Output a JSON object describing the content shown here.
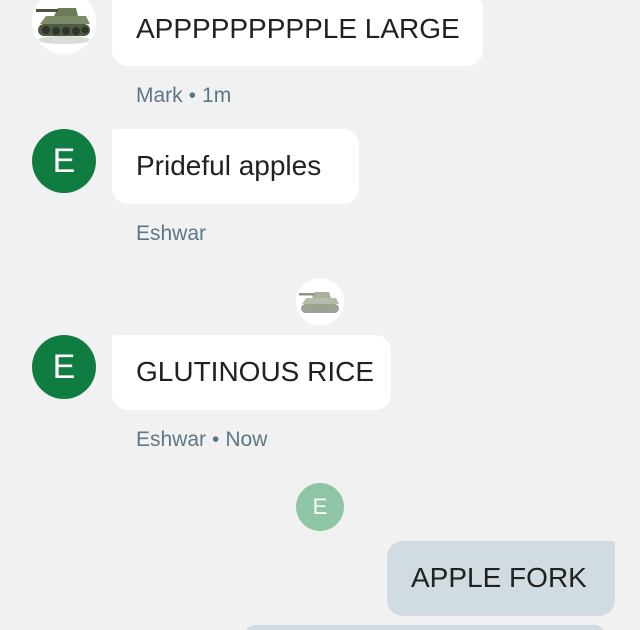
{
  "messages": [
    {
      "sender": "Mark",
      "text": "APPPPPPPPPLE LARGE",
      "time": "1m",
      "avatar_icon": "tank-avatar-icon"
    },
    {
      "sender": "Eshwar",
      "text": "Prideful apples",
      "avatar_letter": "E"
    },
    {
      "sender": "Eshwar",
      "text": "GLUTINOUS RICE",
      "time": "Now",
      "avatar_letter": "E"
    },
    {
      "text": "APPLE FORK",
      "direction": "outgoing"
    }
  ],
  "separator": "•",
  "read_receipts": {
    "mark_icon": "tank-avatar-icon",
    "eshwar_letter": "E"
  },
  "colors": {
    "background": "#f1f1f1",
    "incoming_bubble": "#ffffff",
    "outgoing_bubble": "#d1dbe2",
    "avatar_green": "#0f7d41",
    "receipt_green": "#8ec5a4",
    "meta_text": "#5f7785"
  }
}
